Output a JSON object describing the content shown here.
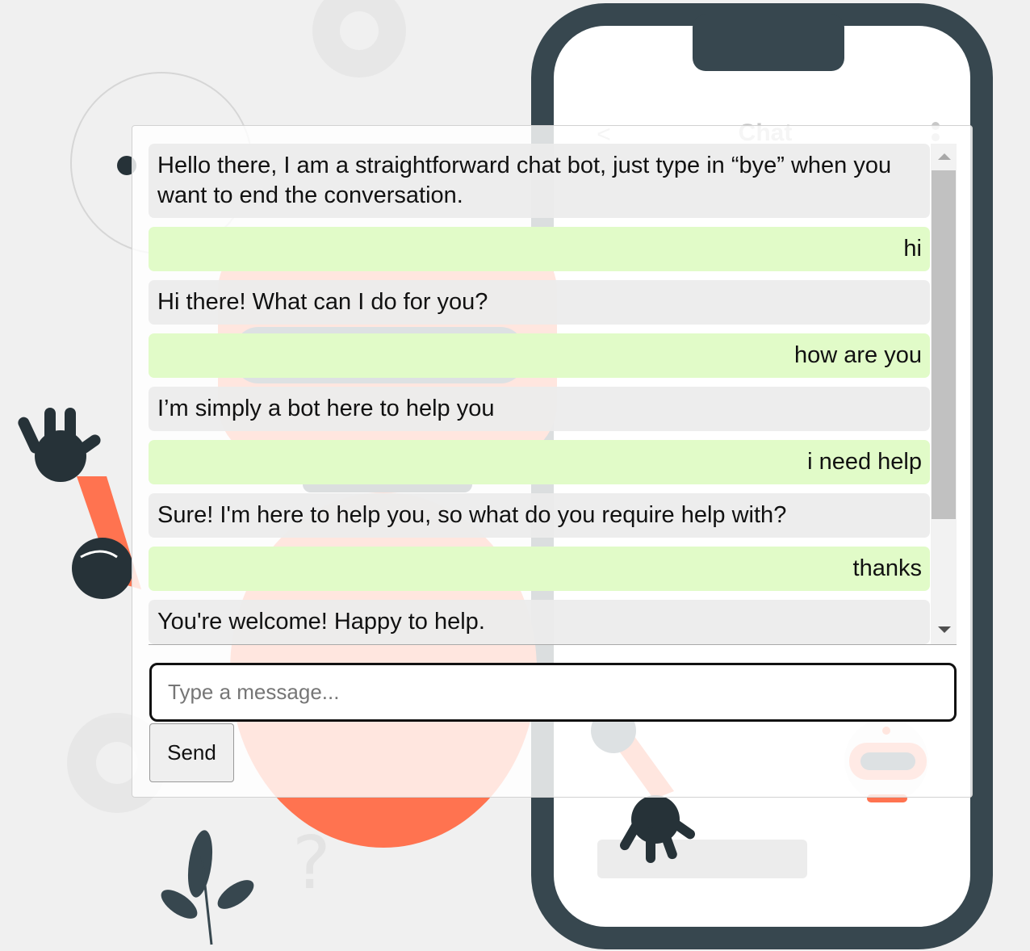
{
  "background": {
    "phone_header_title": "Chat",
    "back_glyph": "<"
  },
  "chat": {
    "messages": [
      {
        "role": "bot",
        "text": "Hello there, I am a straightforward chat bot, just type in “bye” when you want to end the conversation."
      },
      {
        "role": "user",
        "text": "hi"
      },
      {
        "role": "bot",
        "text": "Hi there! What can I do for you?"
      },
      {
        "role": "user",
        "text": "how are you"
      },
      {
        "role": "bot",
        "text": "I’m simply a bot here to help you"
      },
      {
        "role": "user",
        "text": "i need help"
      },
      {
        "role": "bot",
        "text": "Sure! I'm here to help you, so what do you require help with?"
      },
      {
        "role": "user",
        "text": "thanks"
      },
      {
        "role": "bot",
        "text": "You're welcome! Happy to help."
      }
    ],
    "input": {
      "value": "",
      "placeholder": "Type a message..."
    },
    "send_label": "Send"
  },
  "colors": {
    "bot_bubble": "#ececec",
    "user_bubble": "#e1fbc8",
    "phone_frame": "#37474f",
    "robot_accent": "#ff7350",
    "input_border": "#111111"
  },
  "icons": [
    "robot-illustration",
    "phone-illustration",
    "gear-icon",
    "question-mark-icon",
    "leaf-icon",
    "robot-avatar-icon",
    "more-vert-icon",
    "back-arrow-icon"
  ]
}
